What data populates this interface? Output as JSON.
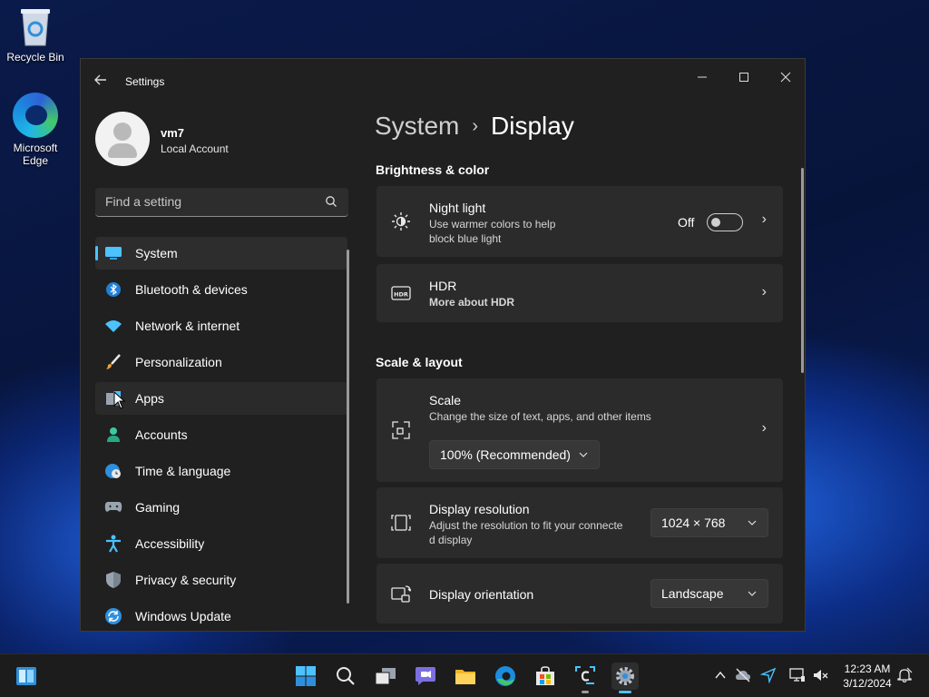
{
  "desktop": {
    "icons": [
      {
        "label": "Recycle Bin"
      },
      {
        "label": "Microsoft Edge"
      }
    ]
  },
  "window": {
    "title": "Settings",
    "controls": {
      "minimize": "—",
      "maximize": "☐",
      "close": "✕"
    }
  },
  "profile": {
    "name": "vm7",
    "type": "Local Account"
  },
  "search": {
    "placeholder": "Find a setting"
  },
  "sidebar": {
    "items": [
      {
        "label": "System",
        "icon": "monitor-icon",
        "active": true
      },
      {
        "label": "Bluetooth & devices",
        "icon": "bluetooth-icon"
      },
      {
        "label": "Network & internet",
        "icon": "wifi-icon"
      },
      {
        "label": "Personalization",
        "icon": "brush-icon"
      },
      {
        "label": "Apps",
        "icon": "apps-icon"
      },
      {
        "label": "Accounts",
        "icon": "person-icon"
      },
      {
        "label": "Time & language",
        "icon": "clock-globe-icon"
      },
      {
        "label": "Gaming",
        "icon": "gamepad-icon"
      },
      {
        "label": "Accessibility",
        "icon": "accessibility-icon"
      },
      {
        "label": "Privacy & security",
        "icon": "shield-icon"
      },
      {
        "label": "Windows Update",
        "icon": "update-icon"
      }
    ]
  },
  "breadcrumb": {
    "parent": "System",
    "separator": "›",
    "current": "Display"
  },
  "sections": {
    "brightness": "Brightness & color",
    "scale_layout": "Scale & layout"
  },
  "night_light": {
    "title": "Night light",
    "subtitle_line1": "Use warmer colors to help",
    "subtitle_line2": "block blue light",
    "state": "Off"
  },
  "hdr": {
    "title": "HDR",
    "link": "More about HDR",
    "badge": "HDR"
  },
  "scale": {
    "title": "Scale",
    "subtitle": "Change the size of text, apps, and other items",
    "value": "100% (Recommended)"
  },
  "resolution": {
    "title": "Display resolution",
    "subtitle_line1": "Adjust the resolution to fit your connecte",
    "subtitle_line2": "d display",
    "value": "1024 × 768"
  },
  "orientation": {
    "title": "Display orientation",
    "value": "Landscape"
  },
  "taskbar": {
    "pinned": [
      "start-icon",
      "search-icon",
      "task-view-icon",
      "chat-icon",
      "file-explorer-icon",
      "edge-icon",
      "store-icon",
      "snipping-icon",
      "settings-icon"
    ],
    "tray_chevron": "^"
  },
  "clock": {
    "time": "12:23 AM",
    "date": "3/12/2024"
  },
  "colors": {
    "accent": "#4cc2ff",
    "window_bg": "#202020",
    "card_bg": "#2b2b2b",
    "link": "#8fd3ff"
  }
}
